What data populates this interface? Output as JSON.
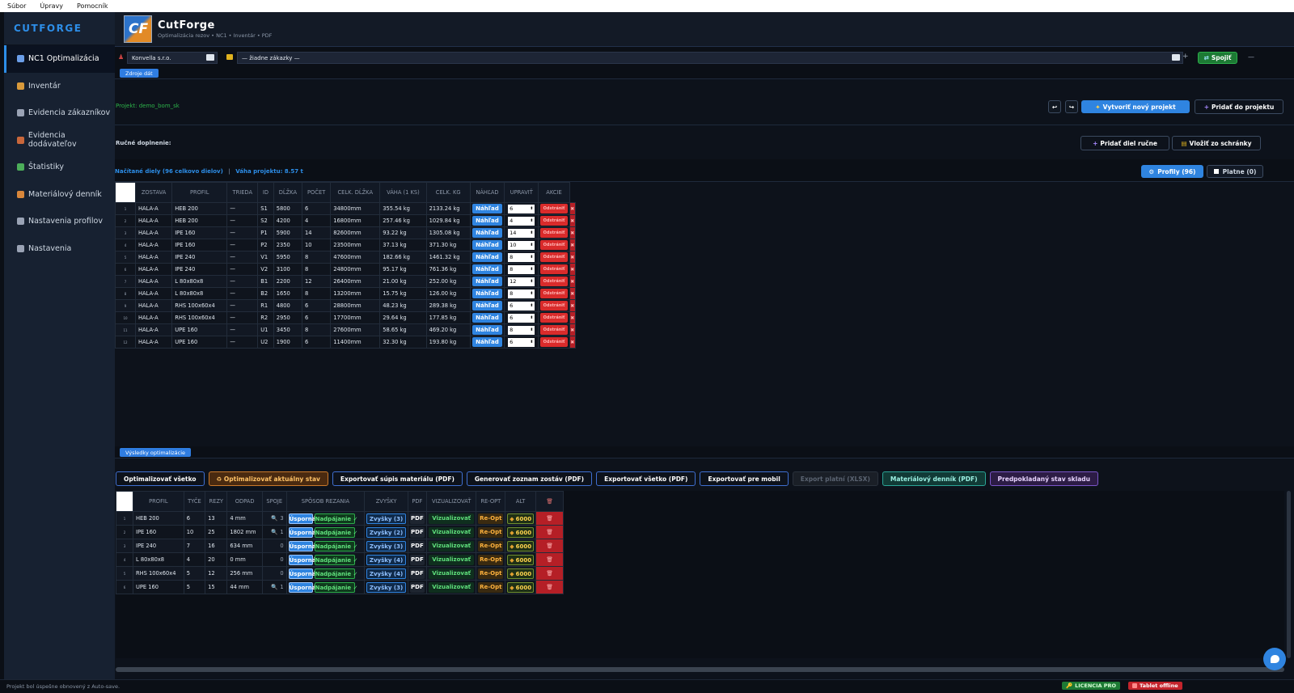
{
  "menu": [
    "Súbor",
    "Úpravy",
    "Pomocník"
  ],
  "sidebar": {
    "brand": "CUTFORGE",
    "items": [
      {
        "label": "NC1  Optimalizácia",
        "icon": "scissors-icon",
        "color": "#6b9ee8",
        "active": true
      },
      {
        "label": "Inventár",
        "icon": "box-icon",
        "color": "#d99a3b"
      },
      {
        "label": "Evidencia zákazníkov",
        "icon": "contacts-icon",
        "color": "#9aa3b5"
      },
      {
        "label": "Evidencia dodávateľov",
        "icon": "factory-icon",
        "color": "#c9673b"
      },
      {
        "label": "Štatistiky",
        "icon": "chart-icon",
        "color": "#4cae5a"
      },
      {
        "label": "Materiálový denník",
        "icon": "notebook-icon",
        "color": "#d9873b"
      },
      {
        "label": "Nastavenia profilov",
        "icon": "wrench-icon",
        "color": "#9aa3b5"
      },
      {
        "label": "Nastavenia",
        "icon": "gear-icon",
        "color": "#9aa3b5"
      }
    ]
  },
  "header": {
    "title": "CutForge",
    "subtitle": "Optimalizácia rezov • NC1 • Inventár • PDF"
  },
  "controls": {
    "customer": "Konvella s.r.o.",
    "order": "— žiadne zákazky —",
    "plus": "+",
    "connect": "Spojiť",
    "minimize": "—",
    "back": "↩",
    "forward": "↪"
  },
  "sources": {
    "tag": "Zdroje dát",
    "project": "Projekt: demo_bom_sk",
    "new_project": "Vytvoriť nový projekt",
    "add_to_project": "Pridať do projektu",
    "manual_label": "Ručné doplnenie:",
    "add_manual": "Pridať diel ručne",
    "paste": "Vložiť zo schránky",
    "loaded": "Načítané diely (96 celkovo dielov)",
    "sep": "|",
    "weight": "Váha projektu: 8.57 t",
    "toggle_profiles": "Profily (96)",
    "toggle_valid": "Platne (0)"
  },
  "parts": {
    "headers": [
      "ZOSTAVA",
      "PROFIL",
      "TRIEDA",
      "ID",
      "DĹŽKA",
      "POČET",
      "CELK. DĹŽKA",
      "VÁHA (1 KS)",
      "CELK. KG",
      "NÁHĽAD",
      "UPRAVIŤ",
      "AKCIE"
    ],
    "preview_label": "Náhľad",
    "remove_label": "Odstrániť",
    "x_label": "✖",
    "rows": [
      {
        "idx": "1",
        "zostava": "HALA-A",
        "profil": "HEB 200",
        "trieda": "—",
        "id": "S1",
        "dlzka": "5800",
        "pocet": "6",
        "celk": "34800mm",
        "vaha": "355.54 kg",
        "kg": "2133.24 kg",
        "edit": "6"
      },
      {
        "idx": "2",
        "zostava": "HALA-A",
        "profil": "HEB 200",
        "trieda": "—",
        "id": "S2",
        "dlzka": "4200",
        "pocet": "4",
        "celk": "16800mm",
        "vaha": "257.46 kg",
        "kg": "1029.84 kg",
        "edit": "4"
      },
      {
        "idx": "3",
        "zostava": "HALA-A",
        "profil": "IPE 160",
        "trieda": "—",
        "id": "P1",
        "dlzka": "5900",
        "pocet": "14",
        "celk": "82600mm",
        "vaha": "93.22 kg",
        "kg": "1305.08 kg",
        "edit": "14"
      },
      {
        "idx": "4",
        "zostava": "HALA-A",
        "profil": "IPE 160",
        "trieda": "—",
        "id": "P2",
        "dlzka": "2350",
        "pocet": "10",
        "celk": "23500mm",
        "vaha": "37.13 kg",
        "kg": "371.30 kg",
        "edit": "10"
      },
      {
        "idx": "5",
        "zostava": "HALA-A",
        "profil": "IPE 240",
        "trieda": "—",
        "id": "V1",
        "dlzka": "5950",
        "pocet": "8",
        "celk": "47600mm",
        "vaha": "182.66 kg",
        "kg": "1461.32 kg",
        "edit": "8"
      },
      {
        "idx": "6",
        "zostava": "HALA-A",
        "profil": "IPE 240",
        "trieda": "—",
        "id": "V2",
        "dlzka": "3100",
        "pocet": "8",
        "celk": "24800mm",
        "vaha": "95.17 kg",
        "kg": "761.36 kg",
        "edit": "8"
      },
      {
        "idx": "7",
        "zostava": "HALA-A",
        "profil": "L 80x80x8",
        "trieda": "—",
        "id": "B1",
        "dlzka": "2200",
        "pocet": "12",
        "celk": "26400mm",
        "vaha": "21.00 kg",
        "kg": "252.00 kg",
        "edit": "12"
      },
      {
        "idx": "8",
        "zostava": "HALA-A",
        "profil": "L 80x80x8",
        "trieda": "—",
        "id": "B2",
        "dlzka": "1650",
        "pocet": "8",
        "celk": "13200mm",
        "vaha": "15.75 kg",
        "kg": "126.00 kg",
        "edit": "8"
      },
      {
        "idx": "9",
        "zostava": "HALA-A",
        "profil": "RHS 100x60x4",
        "trieda": "—",
        "id": "R1",
        "dlzka": "4800",
        "pocet": "6",
        "celk": "28800mm",
        "vaha": "48.23 kg",
        "kg": "289.38 kg",
        "edit": "6"
      },
      {
        "idx": "10",
        "zostava": "HALA-A",
        "profil": "RHS 100x60x4",
        "trieda": "—",
        "id": "R2",
        "dlzka": "2950",
        "pocet": "6",
        "celk": "17700mm",
        "vaha": "29.64 kg",
        "kg": "177.85 kg",
        "edit": "6"
      },
      {
        "idx": "11",
        "zostava": "HALA-A",
        "profil": "UPE 160",
        "trieda": "—",
        "id": "U1",
        "dlzka": "3450",
        "pocet": "8",
        "celk": "27600mm",
        "vaha": "58.65 kg",
        "kg": "469.20 kg",
        "edit": "8"
      },
      {
        "idx": "12",
        "zostava": "HALA-A",
        "profil": "UPE 160",
        "trieda": "—",
        "id": "U2",
        "dlzka": "1900",
        "pocet": "6",
        "celk": "11400mm",
        "vaha": "32.30 kg",
        "kg": "193.80 kg",
        "edit": "6"
      }
    ]
  },
  "results": {
    "tag": "Výsledky optimalizácie",
    "actions": [
      {
        "label": "Optimalizovať všetko",
        "style": "plain"
      },
      {
        "label": "♻ Optimalizovať aktuálny stav",
        "style": "orange"
      },
      {
        "label": "Exportovať súpis materiálu (PDF)",
        "style": "plain"
      },
      {
        "label": "Generovať zoznam zostáv (PDF)",
        "style": "plain"
      },
      {
        "label": "Exportovať všetko (PDF)",
        "style": "plain"
      },
      {
        "label": "Exportovať pre mobil",
        "style": "plain"
      },
      {
        "label": "Export platní (XLSX)",
        "style": "disabled"
      },
      {
        "label": "Materiálový denník (PDF)",
        "style": "teal"
      },
      {
        "label": "Predpokladaný stav skladu",
        "style": "purple"
      }
    ],
    "headers": [
      "PROFIL",
      "TYČE",
      "REZY",
      "ODPAD",
      "SPOJE",
      "SPÔSOB REZANIA",
      "ZVYŠKY",
      "PDF",
      "VIZUALIZOVAŤ",
      "RE-OPT",
      "ALT"
    ],
    "uspora": "Úsporná",
    "nadpajanie": "Nadpájanie ✓",
    "pdf": "PDF",
    "viz": "Vizualizovať",
    "reopt": "Re-Opt",
    "alt": "6000",
    "rows": [
      {
        "idx": "1",
        "profil": "HEB 200",
        "tyce": "6",
        "rezy": "13",
        "odpad": "4 mm",
        "spoje": "3",
        "zvysky": "Zvyšky (3)"
      },
      {
        "idx": "2",
        "profil": "IPE 160",
        "tyce": "10",
        "rezy": "25",
        "odpad": "1802 mm",
        "spoje": "1",
        "zvysky": "Zvyšky (2)"
      },
      {
        "idx": "3",
        "profil": "IPE 240",
        "tyce": "7",
        "rezy": "16",
        "odpad": "634 mm",
        "spoje": "0",
        "zvysky": "Zvyšky (3)"
      },
      {
        "idx": "4",
        "profil": "L 80x80x8",
        "tyce": "4",
        "rezy": "20",
        "odpad": "0 mm",
        "spoje": "0",
        "zvysky": "Zvyšky (4)"
      },
      {
        "idx": "5",
        "profil": "RHS 100x60x4",
        "tyce": "5",
        "rezy": "12",
        "odpad": "256 mm",
        "spoje": "0",
        "zvysky": "Zvyšky (4)"
      },
      {
        "idx": "6",
        "profil": "UPE 160",
        "tyce": "5",
        "rezy": "15",
        "odpad": "44 mm",
        "spoje": "1",
        "zvysky": "Zvyšky (3)"
      }
    ]
  },
  "status": {
    "message": "Projekt bol úspešne obnovený z Auto-save.",
    "license": "LICENCIA PRO",
    "tablet": "Tablet offline"
  }
}
